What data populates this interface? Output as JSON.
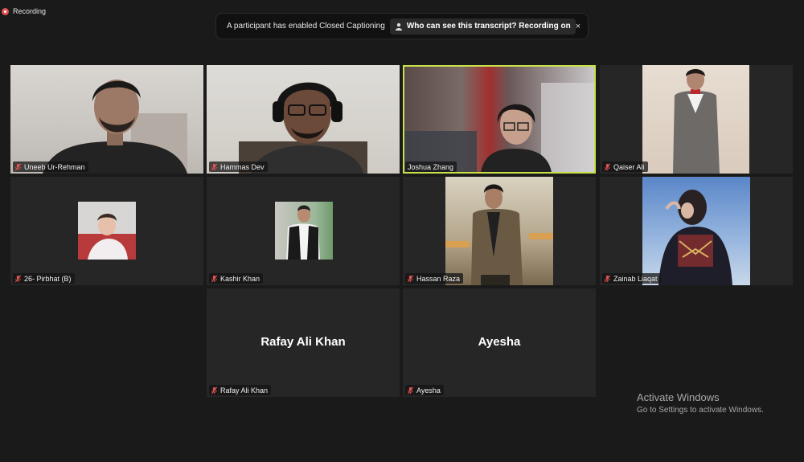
{
  "recording": {
    "label": "Recording"
  },
  "banner": {
    "text": "A participant has enabled Closed Captioning",
    "link": "Who can see this transcript? Recording on",
    "close": "×"
  },
  "participants": [
    {
      "name": "Uneeb Ur-Rehman",
      "video": true
    },
    {
      "name": "Hammas Dev",
      "video": true
    },
    {
      "name": "Joshua Zhang",
      "video": true,
      "active_speaker": true
    },
    {
      "name": "Qaiser Ali",
      "video": true
    },
    {
      "name": "26- Pirbhat (B)",
      "video": true
    },
    {
      "name": "Kashir Khan",
      "video": true
    },
    {
      "name": "Hassan Raza",
      "video": true
    },
    {
      "name": "Zainab Liaqat",
      "video": true
    },
    {
      "name": "Rafay Ali Khan",
      "video": false,
      "display": "Rafay Ali Khan"
    },
    {
      "name": "Ayesha",
      "video": false,
      "display": "Ayesha"
    }
  ],
  "watermark": {
    "line1": "Activate Windows",
    "line2": "Go to Settings to activate Windows."
  },
  "colors": {
    "background": "#1a1a1a",
    "tile": "#262626",
    "active_border": "#c8e04a",
    "muted_icon": "#e05252"
  }
}
